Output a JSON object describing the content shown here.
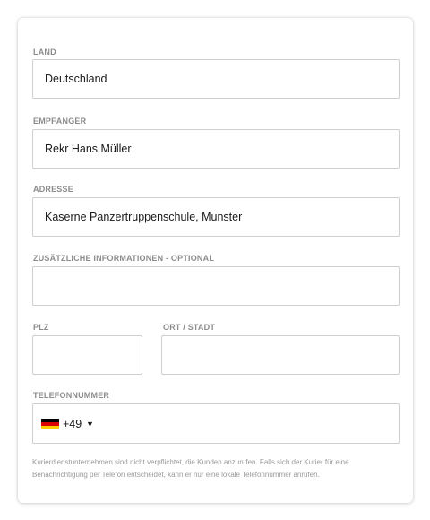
{
  "country": {
    "label": "LAND",
    "value": "Deutschland"
  },
  "recipient": {
    "label": "EMPFÄNGER",
    "value": "Rekr Hans Müller"
  },
  "address": {
    "label": "ADRESSE",
    "value": "Kaserne Panzertruppenschule, Munster"
  },
  "additional": {
    "label": "ZUSÄTZLICHE INFORMATIONEN - OPTIONAL",
    "value": ""
  },
  "zip": {
    "label": "PLZ",
    "value": ""
  },
  "city": {
    "label": "ORT / STADT",
    "value": ""
  },
  "phone": {
    "label": "TELEFONNUMMER",
    "flag_icon": "germany-flag-icon",
    "flag_colors": [
      "#000000",
      "#dd0000",
      "#ffce00"
    ],
    "dial_code": "+49",
    "value": ""
  },
  "note": "Kurierdienstunternehmen sind nicht verpflichtet, die Kunden anzurufen. Falls sich der Kurier für eine Benachrichtigung per Telefon entscheidet, kann er nur eine lokale Telefonnummer anrufen."
}
